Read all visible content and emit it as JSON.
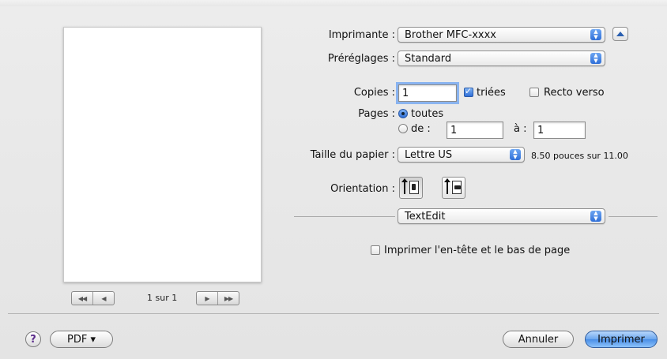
{
  "preview": {
    "page_indicator": "1 sur 1",
    "nav_first": "◀◀",
    "nav_prev": "◀",
    "nav_next": "▶",
    "nav_last": "▶▶"
  },
  "printer": {
    "label": "Imprimante :",
    "value": "Brother MFC-xxxx"
  },
  "presets": {
    "label": "Préréglages :",
    "value": "Standard"
  },
  "copies": {
    "label": "Copies :",
    "value": "1",
    "collated_label": "triées",
    "collated": true,
    "duplex_label": "Recto verso",
    "duplex": false
  },
  "pages": {
    "label": "Pages :",
    "all_label": "toutes",
    "range_label": "de :",
    "from": "1",
    "to_label": "à :",
    "to": "1",
    "selected": "all"
  },
  "paper": {
    "label": "Taille du papier :",
    "value": "Lettre US",
    "size_text": "8.50 pouces sur 11.00"
  },
  "orientation": {
    "label": "Orientation :",
    "selected": "portrait"
  },
  "section": {
    "value": "TextEdit"
  },
  "header_footer": {
    "label": "Imprimer l'en-tête et le bas de page",
    "checked": false
  },
  "footer": {
    "help": "?",
    "pdf": "PDF ▾",
    "cancel": "Annuler",
    "print": "Imprimer"
  }
}
